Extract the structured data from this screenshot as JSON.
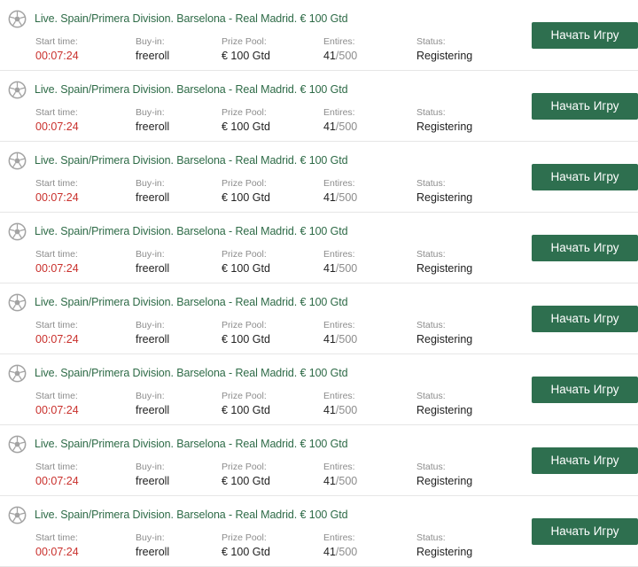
{
  "labels": {
    "start_time": "Start time:",
    "buy_in": "Buy-in:",
    "prize_pool": "Prize Pool:",
    "entires": "Entires:",
    "status": "Status:"
  },
  "icon": "soccer-ball-icon",
  "colors": {
    "title": "#2e6b47",
    "button": "#2e6f4f",
    "time": "#c9302c",
    "label": "#8c8c8c"
  },
  "tournaments": [
    {
      "title": "Live. Spain/Primera Division. Barselona - Real Madrid. € 100 Gtd",
      "start_time": "00:07:24",
      "buy_in": "freeroll",
      "prize_pool": "€ 100 Gtd",
      "entries_current": "41",
      "entries_max": "/500",
      "status": "Registering",
      "button_label": "Начать Игру"
    },
    {
      "title": "Live. Spain/Primera Division. Barselona - Real Madrid. € 100 Gtd",
      "start_time": "00:07:24",
      "buy_in": "freeroll",
      "prize_pool": "€ 100 Gtd",
      "entries_current": "41",
      "entries_max": "/500",
      "status": "Registering",
      "button_label": "Начать Игру"
    },
    {
      "title": "Live. Spain/Primera Division. Barselona - Real Madrid. € 100 Gtd",
      "start_time": "00:07:24",
      "buy_in": "freeroll",
      "prize_pool": "€ 100 Gtd",
      "entries_current": "41",
      "entries_max": "/500",
      "status": "Registering",
      "button_label": "Начать Игру"
    },
    {
      "title": "Live. Spain/Primera Division. Barselona - Real Madrid. € 100 Gtd",
      "start_time": "00:07:24",
      "buy_in": "freeroll",
      "prize_pool": "€ 100 Gtd",
      "entries_current": "41",
      "entries_max": "/500",
      "status": "Registering",
      "button_label": "Начать Игру"
    },
    {
      "title": "Live. Spain/Primera Division. Barselona - Real Madrid. € 100 Gtd",
      "start_time": "00:07:24",
      "buy_in": "freeroll",
      "prize_pool": "€ 100 Gtd",
      "entries_current": "41",
      "entries_max": "/500",
      "status": "Registering",
      "button_label": "Начать Игру"
    },
    {
      "title": "Live. Spain/Primera Division. Barselona - Real Madrid. € 100 Gtd",
      "start_time": "00:07:24",
      "buy_in": "freeroll",
      "prize_pool": "€ 100 Gtd",
      "entries_current": "41",
      "entries_max": "/500",
      "status": "Registering",
      "button_label": "Начать Игру"
    },
    {
      "title": "Live. Spain/Primera Division. Barselona - Real Madrid. € 100 Gtd",
      "start_time": "00:07:24",
      "buy_in": "freeroll",
      "prize_pool": "€ 100 Gtd",
      "entries_current": "41",
      "entries_max": "/500",
      "status": "Registering",
      "button_label": "Начать Игру"
    },
    {
      "title": "Live. Spain/Primera Division. Barselona - Real Madrid. € 100 Gtd",
      "start_time": "00:07:24",
      "buy_in": "freeroll",
      "prize_pool": "€ 100 Gtd",
      "entries_current": "41",
      "entries_max": "/500",
      "status": "Registering",
      "button_label": "Начать Игру"
    }
  ]
}
